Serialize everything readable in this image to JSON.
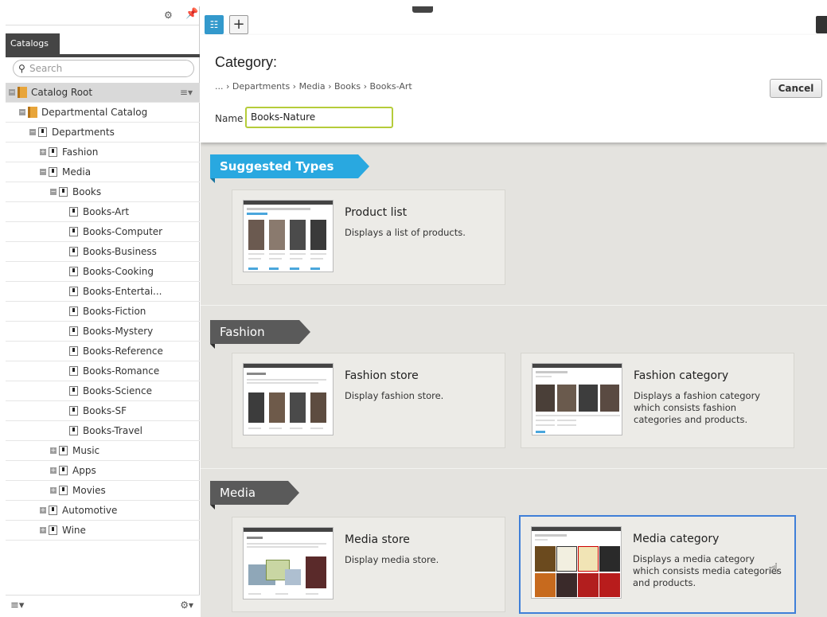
{
  "sidebar": {
    "tab_label": "Catalogs",
    "search_placeholder": "Search",
    "tree": [
      {
        "label": "Catalog Root",
        "level": 0,
        "type": "catalog",
        "expanded": true,
        "selected": true
      },
      {
        "label": "Departmental Catalog",
        "level": 1,
        "type": "catalog",
        "expanded": true
      },
      {
        "label": "Departments",
        "level": 2,
        "type": "node",
        "expanded": true
      },
      {
        "label": "Fashion",
        "level": 3,
        "type": "node",
        "expanded": false
      },
      {
        "label": "Media",
        "level": 3,
        "type": "node",
        "expanded": true
      },
      {
        "label": "Books",
        "level": 4,
        "type": "node",
        "expanded": true
      },
      {
        "label": "Books-Art",
        "level": 5,
        "type": "node"
      },
      {
        "label": "Books-Computer",
        "level": 5,
        "type": "node"
      },
      {
        "label": "Books-Business",
        "level": 5,
        "type": "node"
      },
      {
        "label": "Books-Cooking",
        "level": 5,
        "type": "node"
      },
      {
        "label": "Books-Entertai...",
        "level": 5,
        "type": "node"
      },
      {
        "label": "Books-Fiction",
        "level": 5,
        "type": "node"
      },
      {
        "label": "Books-Mystery",
        "level": 5,
        "type": "node"
      },
      {
        "label": "Books-Reference",
        "level": 5,
        "type": "node"
      },
      {
        "label": "Books-Romance",
        "level": 5,
        "type": "node"
      },
      {
        "label": "Books-Science",
        "level": 5,
        "type": "node"
      },
      {
        "label": "Books-SF",
        "level": 5,
        "type": "node"
      },
      {
        "label": "Books-Travel",
        "level": 5,
        "type": "node"
      },
      {
        "label": "Music",
        "level": 4,
        "type": "node",
        "expanded": false
      },
      {
        "label": "Apps",
        "level": 4,
        "type": "node",
        "expanded": false
      },
      {
        "label": "Movies",
        "level": 4,
        "type": "node",
        "expanded": false
      },
      {
        "label": "Automotive",
        "level": 3,
        "type": "node",
        "expanded": false
      },
      {
        "label": "Wine",
        "level": 3,
        "type": "node",
        "expanded": false
      }
    ]
  },
  "header": {
    "title": "Category:",
    "breadcrumb": "... › Departments › Media › Books › Books-Art",
    "cancel_label": "Cancel",
    "name_label": "Name",
    "name_value": "Books-Nature"
  },
  "sections": {
    "suggested": {
      "title": "Suggested Types",
      "cards": [
        {
          "title": "Product list",
          "description": "Displays a list of products."
        }
      ]
    },
    "fashion": {
      "title": "Fashion",
      "cards": [
        {
          "title": "Fashion store",
          "description": "Display fashion store."
        },
        {
          "title": "Fashion category",
          "description": "Displays a fashion category which consists fashion categories and products."
        }
      ]
    },
    "media": {
      "title": "Media",
      "cards": [
        {
          "title": "Media store",
          "description": "Display media store."
        },
        {
          "title": "Media category",
          "description": "Displays a media category which consists media categories and products."
        }
      ]
    }
  },
  "colors": {
    "accent_blue": "#29a8e0",
    "banner_gray": "#5a5a5a",
    "input_focus": "#b5cc3a",
    "selected_card_border": "#3f7fd8"
  }
}
